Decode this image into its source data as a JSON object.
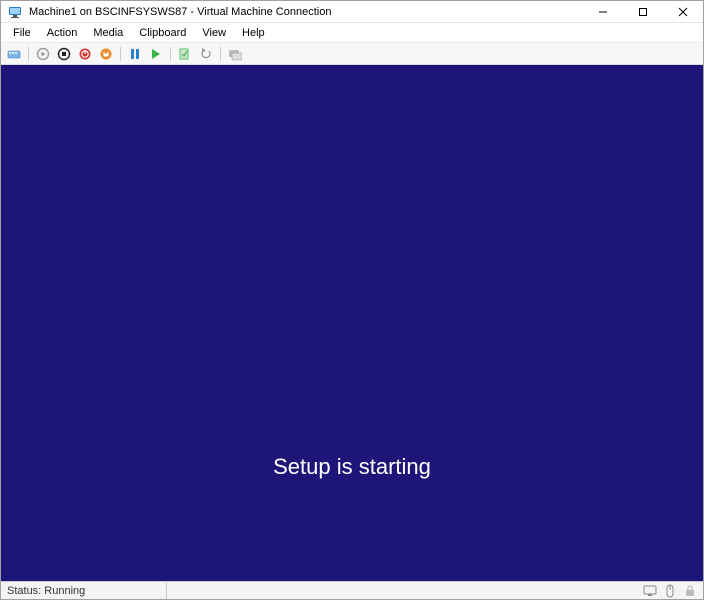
{
  "window": {
    "title": "Machine1 on BSCINFSYSWS87 - Virtual Machine Connection"
  },
  "menu": {
    "file": "File",
    "action": "Action",
    "media": "Media",
    "clipboard": "Clipboard",
    "view": "View",
    "help": "Help"
  },
  "toolbar": {
    "ctrl_alt_del": "ctrl-alt-del",
    "start": "start",
    "turn_off": "turn-off",
    "shutdown": "shutdown",
    "save": "save",
    "pause": "pause",
    "reset": "reset",
    "checkpoint": "checkpoint",
    "revert": "revert",
    "enhanced": "enhanced-session"
  },
  "vm": {
    "message": "Setup is starting"
  },
  "status": {
    "text": "Status: Running"
  }
}
